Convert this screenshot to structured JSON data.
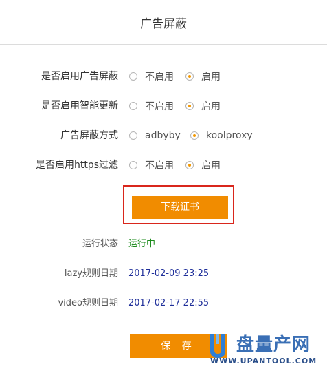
{
  "header": {
    "title": "广告屏蔽"
  },
  "settings": [
    {
      "label": "是否启用广告屏蔽",
      "options": [
        "不启用",
        "启用"
      ],
      "selected": 1
    },
    {
      "label": "是否启用智能更新",
      "options": [
        "不启用",
        "启用"
      ],
      "selected": 1
    },
    {
      "label": "广告屏蔽方式",
      "options": [
        "adbyby",
        "koolproxy"
      ],
      "selected": 1
    },
    {
      "label": "是否启用https过滤",
      "options": [
        "不启用",
        "启用"
      ],
      "selected": 1
    }
  ],
  "download": {
    "label": "下载证书"
  },
  "status": {
    "run_state_label": "运行状态",
    "run_state_value": "运行中",
    "lazy_label": "lazy规则日期",
    "lazy_value": "2017-02-09 23:25",
    "video_label": "video规则日期",
    "video_value": "2017-02-17 22:55"
  },
  "actions": {
    "save_label": "保 存"
  },
  "watermark": {
    "brand_cn": "盘量产网",
    "url": "WWW.UPANTOOL.COM"
  },
  "colors": {
    "accent": "#f18c00",
    "highlight_border": "#d9261c",
    "running_green": "#1a8a1a",
    "date_blue": "#1f2f9a"
  }
}
